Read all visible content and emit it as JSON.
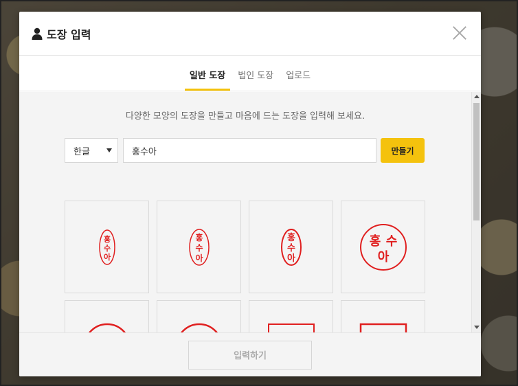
{
  "modal": {
    "title": "도장 입력",
    "icon": "user-icon",
    "close_icon": "close-icon"
  },
  "tabs": [
    {
      "label": "일반 도장",
      "active": true
    },
    {
      "label": "법인 도장",
      "active": false
    },
    {
      "label": "업로드",
      "active": false
    }
  ],
  "content": {
    "description": "다양한 모양의 도장을 만들고 마음에 드는 도장을 입력해 보세요.",
    "language_select": {
      "value": "한글"
    },
    "name_input": {
      "value": "홍수아"
    },
    "make_button": "만들기"
  },
  "stamps": {
    "name": "홍수아",
    "styles": [
      "oval-script",
      "oval-plain",
      "oval-bold",
      "circle-script",
      "circle-bold",
      "circle-plain",
      "square-script",
      "square-bold"
    ]
  },
  "footer": {
    "submit_button": "입력하기"
  },
  "colors": {
    "accent": "#f4c20d",
    "stamp": "#e01f1f"
  }
}
